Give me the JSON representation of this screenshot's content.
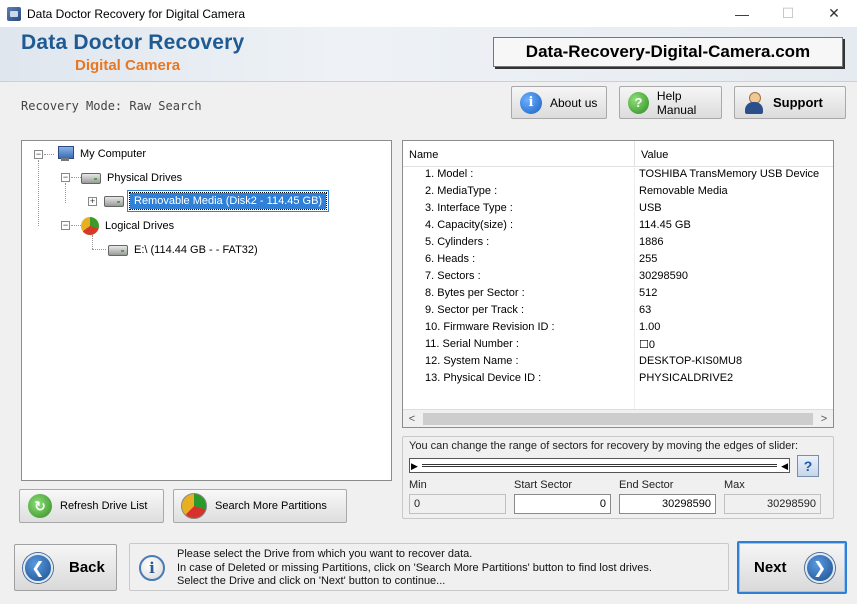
{
  "window": {
    "title": "Data Doctor Recovery for Digital Camera",
    "minimize": "—",
    "maximize": "☐",
    "close": "✕"
  },
  "banner": {
    "brand_line1": "Data Doctor Recovery",
    "brand_line2": "Digital Camera",
    "website": "Data-Recovery-Digital-Camera.com"
  },
  "mode_label": "Recovery Mode: Raw Search",
  "toolbar": {
    "about": "About us",
    "help": "Help Manual",
    "support": "Support"
  },
  "tree": {
    "root": "My Computer",
    "physical": "Physical Drives",
    "removable": "Removable Media (Disk2 - 114.45 GB)",
    "logical": "Logical Drives",
    "volume": "E:\\ (114.44 GB -  - FAT32)"
  },
  "properties": {
    "col_name": "Name",
    "col_value": "Value",
    "rows": [
      {
        "name": "1. Model :",
        "value": "TOSHIBA TransMemory USB Device"
      },
      {
        "name": "2. MediaType :",
        "value": "Removable Media"
      },
      {
        "name": "3. Interface Type :",
        "value": "USB"
      },
      {
        "name": "4. Capacity(size) :",
        "value": "114.45 GB"
      },
      {
        "name": "5. Cylinders :",
        "value": "1886"
      },
      {
        "name": "6. Heads :",
        "value": "255"
      },
      {
        "name": "7. Sectors :",
        "value": "30298590"
      },
      {
        "name": "8. Bytes per Sector :",
        "value": "512"
      },
      {
        "name": "9. Sector per Track :",
        "value": "63"
      },
      {
        "name": "10. Firmware Revision ID :",
        "value": "1.00"
      },
      {
        "name": "11. Serial Number :",
        "value": "☐0"
      },
      {
        "name": "12. System Name :",
        "value": "DESKTOP-KIS0MU8"
      },
      {
        "name": "13. Physical Device ID :",
        "value": "PHYSICALDRIVE2"
      }
    ]
  },
  "slider": {
    "instruction": "You can change the range of sectors for recovery by moving the edges of slider:",
    "min_label": "Min",
    "start_label": "Start Sector",
    "end_label": "End Sector",
    "max_label": "Max",
    "min_value": "0",
    "start_value": "0",
    "end_value": "30298590",
    "max_value": "30298590"
  },
  "buttons": {
    "refresh": "Refresh Drive List",
    "search_partitions": "Search More Partitions",
    "back": "Back",
    "next": "Next"
  },
  "info": {
    "line1": "Please select the Drive from which you want to recover data.",
    "line2": "In case of Deleted or missing Partitions, click on 'Search More Partitions' button to find lost drives.",
    "line3": "Select the Drive and click on 'Next' button to continue..."
  }
}
